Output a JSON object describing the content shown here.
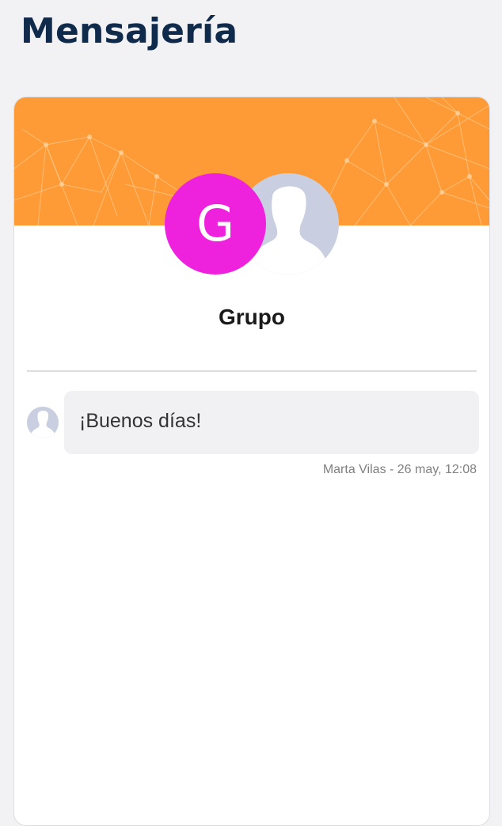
{
  "page": {
    "title": "Mensajería"
  },
  "colors": {
    "title": "#0f2a4a",
    "banner": "#ff9b36",
    "group_avatar": "#ee22dd",
    "placeholder_avatar": "#c9cfe0"
  },
  "group": {
    "avatar_letter": "G",
    "name": "Grupo",
    "member_avatar_icon": "person-silhouette-icon"
  },
  "messages": [
    {
      "text": "¡Buenos días!",
      "meta": "Marta Vilas - 26 may, 12:08",
      "avatar_icon": "person-silhouette-icon"
    }
  ]
}
